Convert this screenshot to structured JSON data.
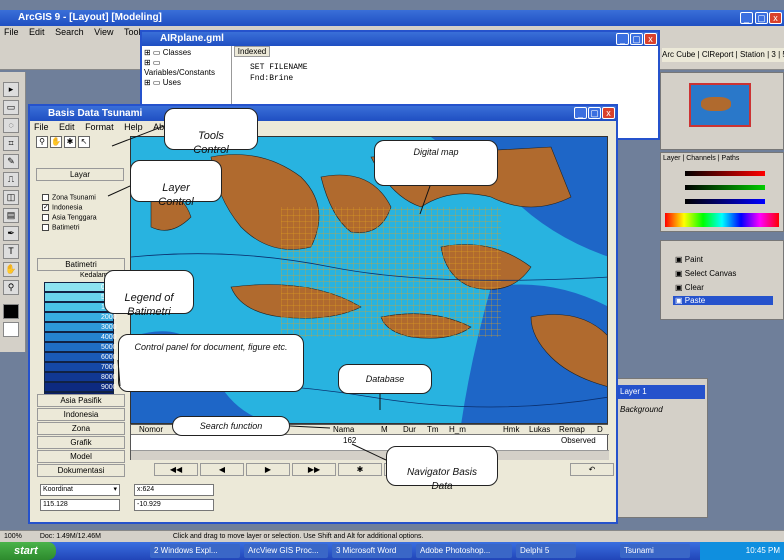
{
  "photoshop": {
    "title": "ArcGIS 9 - [Layout] [Modeling]",
    "menu": [
      "File",
      "Edit",
      "Search",
      "View",
      "Tool"
    ],
    "right_menu": "Arc Cube | ClReport | Station | 3 | 5"
  },
  "editor": {
    "title": "AIRplane.gml",
    "tab": "Indexed",
    "tree": [
      "Classes",
      "Variables/Constants",
      "Uses"
    ],
    "code": [
      "SET FILENAME",
      "",
      "Fnd:Brine"
    ]
  },
  "main_window": {
    "title": "Basis Data Tsunami",
    "menu": [
      "File",
      "Edit",
      "Format",
      "Help",
      "About"
    ],
    "layer_header": "Layar",
    "layers": [
      {
        "label": "Zona Tsunami",
        "checked": false
      },
      {
        "label": "Indonesia",
        "checked": true
      },
      {
        "label": "Asia Tenggara",
        "checked": false
      },
      {
        "label": "Batimetri",
        "checked": false
      }
    ],
    "legend_header": "Batimetri",
    "legend_sub": "Kedalaman",
    "legend_values": [
      "0",
      "500",
      "1000",
      "2000",
      "3000",
      "4000",
      "5000",
      "6000",
      "7000",
      "8000",
      "9000",
      "10000"
    ],
    "side_buttons": [
      "Asia Pasifik",
      "Indonesia",
      "Zona",
      "Grafik",
      "Model",
      "Dokumentasi"
    ],
    "coord_label": "Koordinat",
    "coord_value": "115.128",
    "coord_b1": "x:624",
    "coord_b2": "-10.929",
    "table_headers": [
      "Nomor",
      "Nama",
      "M",
      "Dur",
      "Tm",
      "H_m",
      "Hmk",
      "Lukas",
      "Remap",
      "D"
    ],
    "table_row_value": "162",
    "table_row_status": "Observed",
    "nav_buttons": [
      "◀◀",
      "◀",
      "▶",
      "▶▶",
      "✱",
      "",
      "↶"
    ]
  },
  "callouts": {
    "tools": "Tools\nControl",
    "layer": "Layer\nControl",
    "digital_map": "Digital map",
    "legend": "Legend of\nBatimetri",
    "control_panel": "Control panel for document, figure etc.",
    "database": "Database",
    "search": "Search function",
    "navigator": "Navigator Basis\nData"
  },
  "right_panels": {
    "layers_title": "Layer 1",
    "layers_sub": "Background",
    "history": [
      "Paint",
      "Select Canvas",
      "Clear",
      "Paste"
    ],
    "tabs": [
      "Layer",
      "Channels",
      "Paths"
    ]
  },
  "status_bar": {
    "zoom": "100%",
    "doc": "Doc: 1.49M/12.46M",
    "hint": "Click and drag to move layer or selection. Use Shift and Alt for additional options."
  },
  "taskbar": {
    "start": "start",
    "tasks": [
      "2 Windows Expl...",
      "ArcView GIS Proc...",
      "3 Microsoft Word",
      "Adobe Photoshop...",
      "Delphi 5",
      "Tsunami"
    ],
    "clock": "10:45 PM"
  },
  "colors": {
    "ocean_deep": "#1e66c7",
    "ocean_shallow": "#28b3e0",
    "land": "#b06a2e",
    "grid": "#e0a020",
    "xp_blue": "#2552cc"
  }
}
